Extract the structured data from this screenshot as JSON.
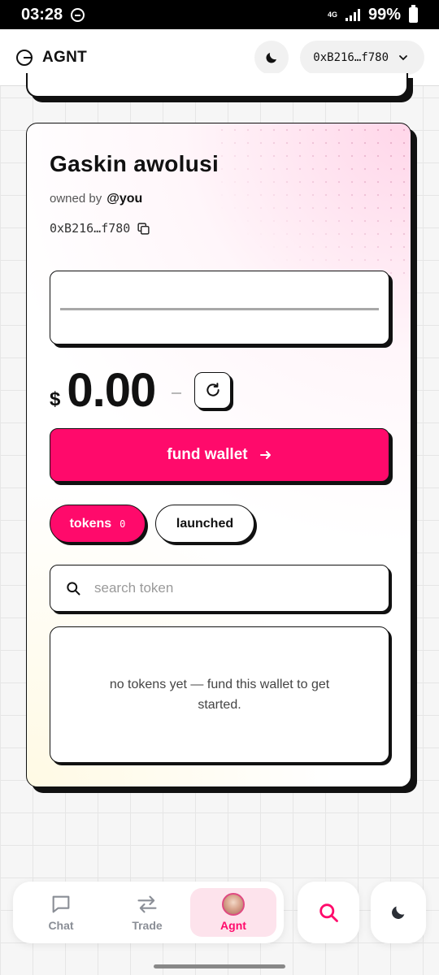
{
  "status_bar": {
    "time": "03:28",
    "network": "4G",
    "battery": "99%"
  },
  "header": {
    "brand": "AGNT",
    "wallet_address": "0xB216…f780"
  },
  "card": {
    "title": "Gaskin awolusi",
    "owned_by_label": "owned by",
    "owner": "@you",
    "address": "0xB216…f780",
    "name_input_value": "",
    "currency_symbol": "$",
    "balance": "0.00",
    "change": "–",
    "fund_button": "fund wallet",
    "tabs": [
      {
        "label": "tokens",
        "count": "0",
        "active": true
      },
      {
        "label": "launched",
        "active": false
      }
    ],
    "search_placeholder": "search token",
    "empty_message": "no tokens yet — fund this wallet to get started."
  },
  "bottom_nav": {
    "items": [
      {
        "label": "Chat",
        "icon": "chat-icon",
        "active": false
      },
      {
        "label": "Trade",
        "icon": "swap-icon",
        "active": false
      },
      {
        "label": "Agnt",
        "icon": "avatar",
        "active": true
      }
    ]
  },
  "colors": {
    "accent": "#ff0a6b",
    "accent_soft": "#fde3ec",
    "ink": "#111111"
  }
}
